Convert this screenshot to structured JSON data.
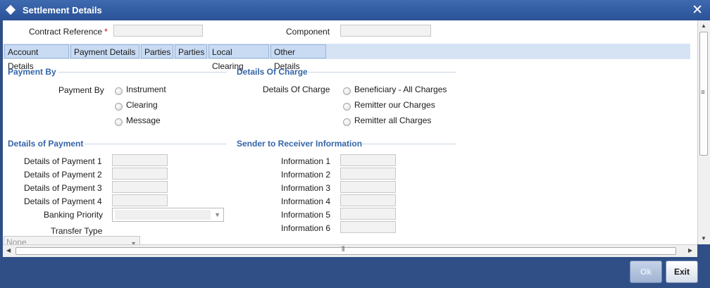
{
  "window": {
    "title": "Settlement Details",
    "close_glyph": "✕"
  },
  "header": {
    "contract_reference_label": "Contract Reference",
    "required_mark": "*",
    "contract_reference_value": "",
    "component_label": "Component",
    "component_value": ""
  },
  "tabs": [
    {
      "label": "Account Details"
    },
    {
      "label": "Payment Details"
    },
    {
      "label": "Parties"
    },
    {
      "label": "Parties"
    },
    {
      "label": "Local Clearing"
    },
    {
      "label": "Other Details"
    }
  ],
  "payment_by": {
    "section_title": "Payment By",
    "field_label": "Payment By",
    "options": [
      "Instrument",
      "Clearing",
      "Message"
    ]
  },
  "details_of_charge": {
    "section_title": "Details Of Charge",
    "field_label": "Details Of Charge",
    "options": [
      "Beneficiary - All Charges",
      "Remitter our Charges",
      "Remitter all Charges"
    ]
  },
  "details_of_payment": {
    "section_title": "Details of Payment",
    "labels": [
      "Details of Payment 1",
      "Details of Payment 2",
      "Details of Payment 3",
      "Details of Payment 4"
    ],
    "values": [
      "",
      "",
      "",
      ""
    ],
    "banking_priority_label": "Banking Priority",
    "banking_priority_value": "",
    "transfer_type_label": "Transfer Type",
    "transfer_type_value": "None"
  },
  "sender_info": {
    "section_title": "Sender to Receiver Information",
    "labels": [
      "Information 1",
      "Information 2",
      "Information 3",
      "Information 4",
      "Information 5",
      "Information 6"
    ],
    "values": [
      "",
      "",
      "",
      "",
      "",
      ""
    ]
  },
  "footer": {
    "ok_label": "Ok",
    "exit_label": "Exit"
  },
  "icons": {
    "title": "diamond-icon",
    "close": "close-icon",
    "dropdown": "chevron-down-icon"
  },
  "colors": {
    "titlebar": "#2a5297",
    "section_title": "#3565a8",
    "required": "#d00000",
    "tab_bg": "#c9dbf3"
  }
}
